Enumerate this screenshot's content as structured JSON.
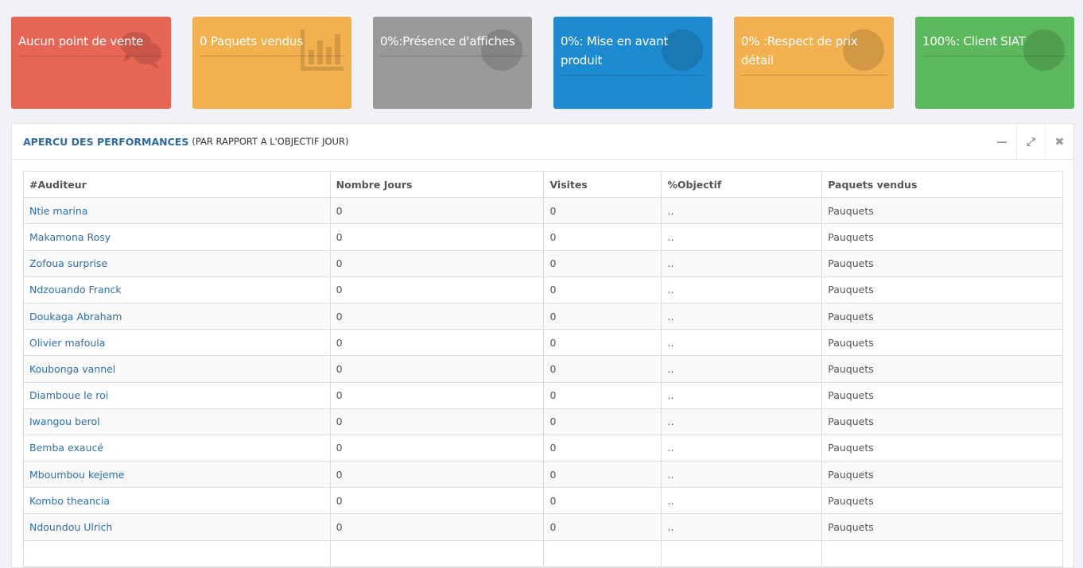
{
  "cards": [
    {
      "text": "Aucun point de vente",
      "color": "#e76555",
      "icon": "comments-icon"
    },
    {
      "text": "0 Paquets vendus",
      "color": "#f3b04e",
      "icon": "bar-chart-icon"
    },
    {
      "text": "0%:Présence d'affiches",
      "color": "#999999",
      "icon": "globe-icon"
    },
    {
      "text": "0%: Mise en avant produit",
      "color": "#1e8bd1",
      "icon": "globe-icon"
    },
    {
      "text": "0% :Respect de prix détail",
      "color": "#f3b04e",
      "icon": "globe-icon"
    },
    {
      "text": "100%: Client SIAT",
      "color": "#5cb85c",
      "icon": "globe-icon"
    }
  ],
  "panel": {
    "title": "APERCU DES PERFORMANCES",
    "subtitle": "(PAR RAPPORT A L'OBJECTIF JOUR)"
  },
  "table": {
    "headers": [
      "#Auditeur",
      "Nombre Jours",
      "Visites",
      "%Objectif",
      "Paquets vendus"
    ],
    "rows": [
      [
        "Ntie marina",
        "0",
        "0",
        "..",
        "Pauquets"
      ],
      [
        "Makamona Rosy",
        "0",
        "0",
        "..",
        "Pauquets"
      ],
      [
        "Zofoua surprise",
        "0",
        "0",
        "..",
        "Pauquets"
      ],
      [
        "Ndzouando Franck",
        "0",
        "0",
        "..",
        "Pauquets"
      ],
      [
        "Doukaga Abraham",
        "0",
        "0",
        "..",
        "Pauquets"
      ],
      [
        "Olivier mafoula",
        "0",
        "0",
        "..",
        "Pauquets"
      ],
      [
        "Koubonga vannel",
        "0",
        "0",
        "..",
        "Pauquets"
      ],
      [
        "Diamboue le roi",
        "0",
        "0",
        "..",
        "Pauquets"
      ],
      [
        "Iwangou berol",
        "0",
        "0",
        "..",
        "Pauquets"
      ],
      [
        "Bemba exaucé",
        "0",
        "0",
        "..",
        "Pauquets"
      ],
      [
        "Mboumbou kejeme",
        "0",
        "0",
        "..",
        "Pauquets"
      ],
      [
        "Kombo theancia",
        "0",
        "0",
        "..",
        "Pauquets"
      ],
      [
        "Ndoundou Ulrich",
        "0",
        "0",
        "..",
        "Pauquets"
      ]
    ]
  }
}
